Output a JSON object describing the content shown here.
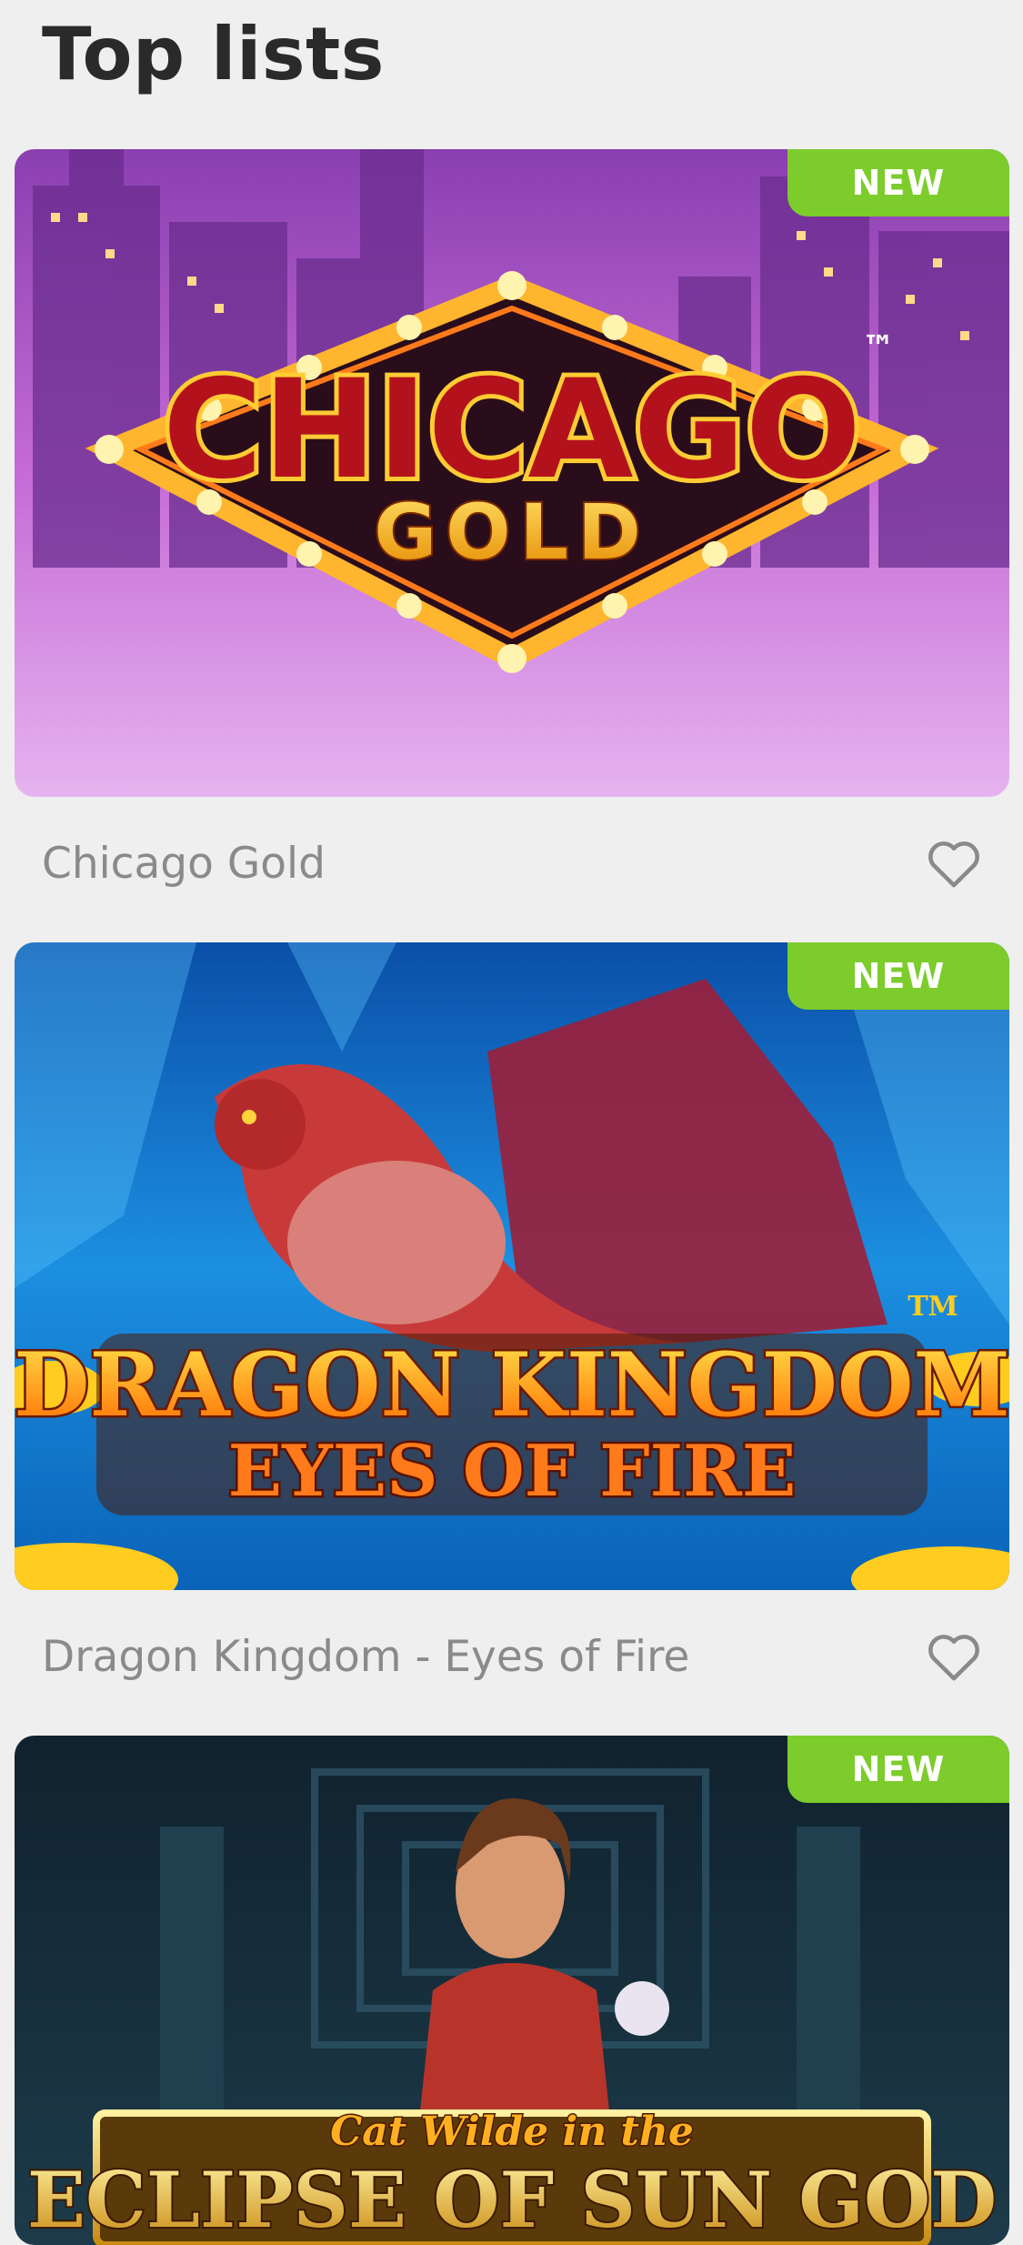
{
  "page": {
    "title": "Top lists"
  },
  "badge_color": "#7ccc2c",
  "games": [
    {
      "name": "Chicago Gold",
      "badge": "NEW",
      "art": {
        "logo_line1": "CHICAGO",
        "logo_line2": "GOLD",
        "tm": "™"
      }
    },
    {
      "name": "Dragon Kingdom - Eyes of Fire",
      "badge": "NEW",
      "art": {
        "logo_line1": "DRAGON KINGDOM",
        "logo_line2": "EYES OF FIRE",
        "tm": "TM"
      }
    },
    {
      "name": "",
      "badge": "NEW",
      "art": {
        "logo_line1": "Cat Wilde in the",
        "logo_line2": "ECLIPSE OF SUN GOD"
      }
    }
  ],
  "icons": {
    "favorite": "heart-outline-icon"
  }
}
